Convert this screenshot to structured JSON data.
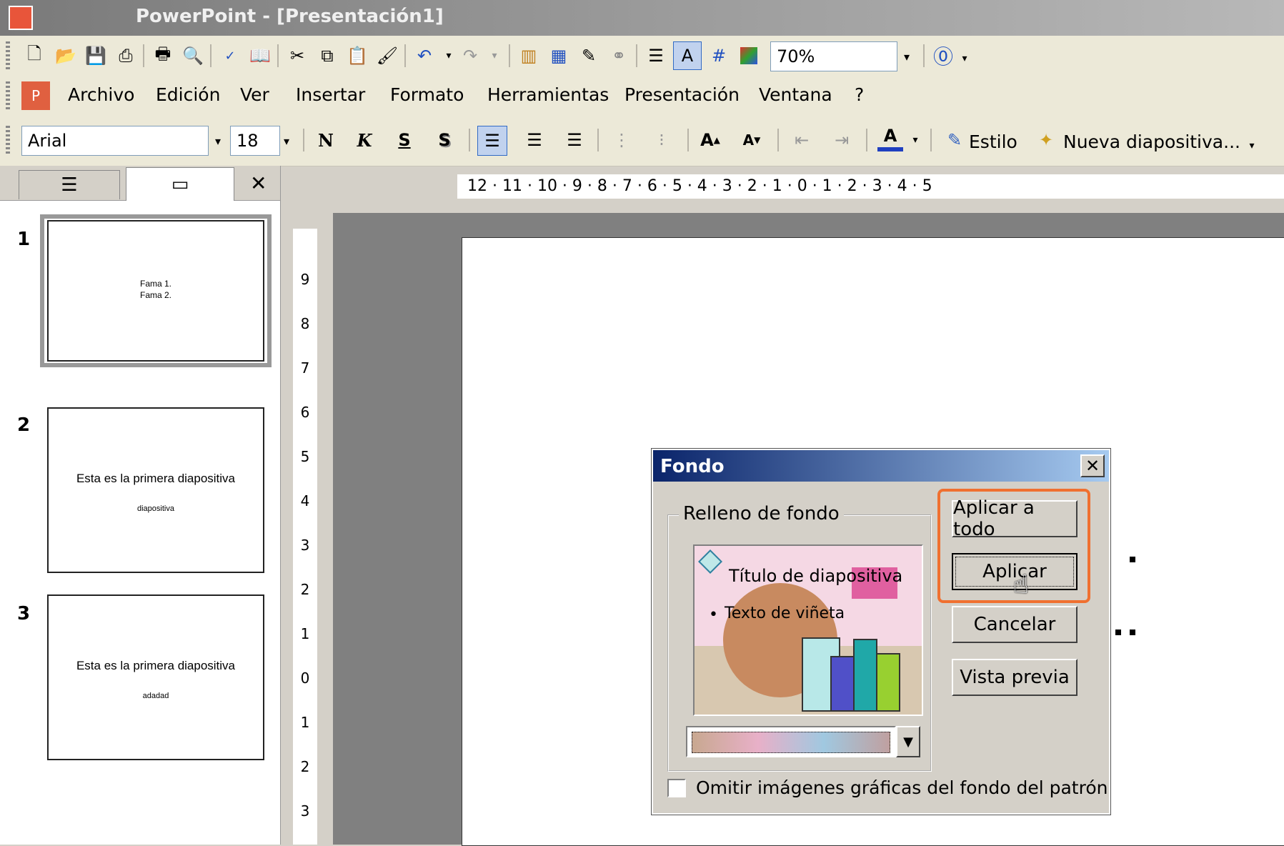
{
  "window": {
    "title": "PowerPoint - [Presentación1]"
  },
  "toolbar_standard": {
    "zoom_value": "70%"
  },
  "menu": {
    "items": [
      "Archivo",
      "Edición",
      "Ver",
      "Insertar",
      "Formato",
      "Herramientas",
      "Presentación",
      "Ventana",
      "?"
    ]
  },
  "toolbar_format": {
    "font": "Arial",
    "size": "18",
    "bold": "N",
    "italic": "K",
    "underline": "S",
    "shadow": "S",
    "style_label": "Estilo",
    "new_slide_label": "Nueva diapositiva..."
  },
  "ruler": {
    "horizontal": "12 · 11 · 10 · 9 · 8 · 7 · 6 · 5 · 4 · 3 · 2 · 1 · 0 · 1 · 2 · 3 · 4 · 5",
    "vertical": [
      "9",
      "8",
      "7",
      "6",
      "5",
      "4",
      "3",
      "2",
      "1",
      "0",
      "1",
      "2",
      "3"
    ]
  },
  "slides": [
    {
      "num": "1",
      "line1": "Fama 1.",
      "line2": "Fama 2."
    },
    {
      "num": "2",
      "line1": "Esta es la primera diapositiva",
      "line2": "diapositiva"
    },
    {
      "num": "3",
      "line1": "Esta es la primera diapositiva",
      "line2": "adadad"
    }
  ],
  "dialog": {
    "title": "Fondo",
    "group_label": "Relleno de fondo",
    "preview_title": "Título de diapositiva",
    "preview_bullet": "Texto de viñeta",
    "apply_all": "Aplicar a todo",
    "apply": "Aplicar",
    "cancel": "Cancelar",
    "preview": "Vista previa",
    "omit_label": "Omitir imágenes gráficas del fondo del patrón"
  },
  "colors": {
    "highlight": "#f07030",
    "dialog_title_start": "#0a246a",
    "dialog_title_end": "#a6caf0"
  }
}
